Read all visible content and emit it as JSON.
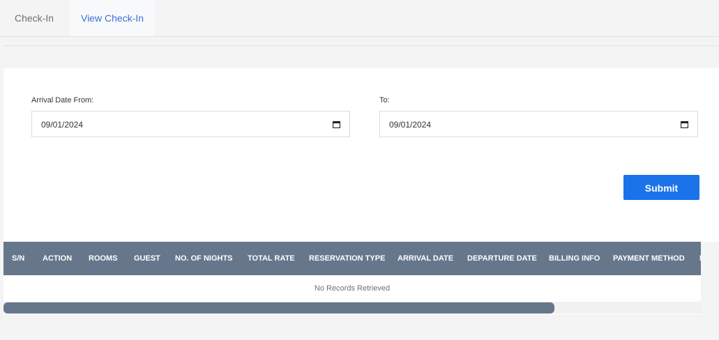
{
  "tabs": [
    {
      "label": "Check-In",
      "active": false
    },
    {
      "label": "View Check-In",
      "active": true
    }
  ],
  "filters": {
    "from_label": "Arrival Date From:",
    "from_value": "09/01/2024",
    "to_label": "To:",
    "to_value": "09/01/2024",
    "icon": "calendar-icon"
  },
  "submit_label": "Submit",
  "table": {
    "columns": [
      "S/N",
      "ACTION",
      "ROOMS",
      "GUEST",
      "NO. OF NIGHTS",
      "TOTAL RATE",
      "RESERVATION TYPE",
      "ARRIVAL DATE",
      "DEPARTURE DATE",
      "BILLING INFO",
      "PAYMENT METHOD",
      "I"
    ],
    "empty_message": "No Records Retrieved"
  },
  "colors": {
    "accent": "#1a73e8",
    "header_bg": "#66778c",
    "active_tab": "#3b6fd8"
  }
}
